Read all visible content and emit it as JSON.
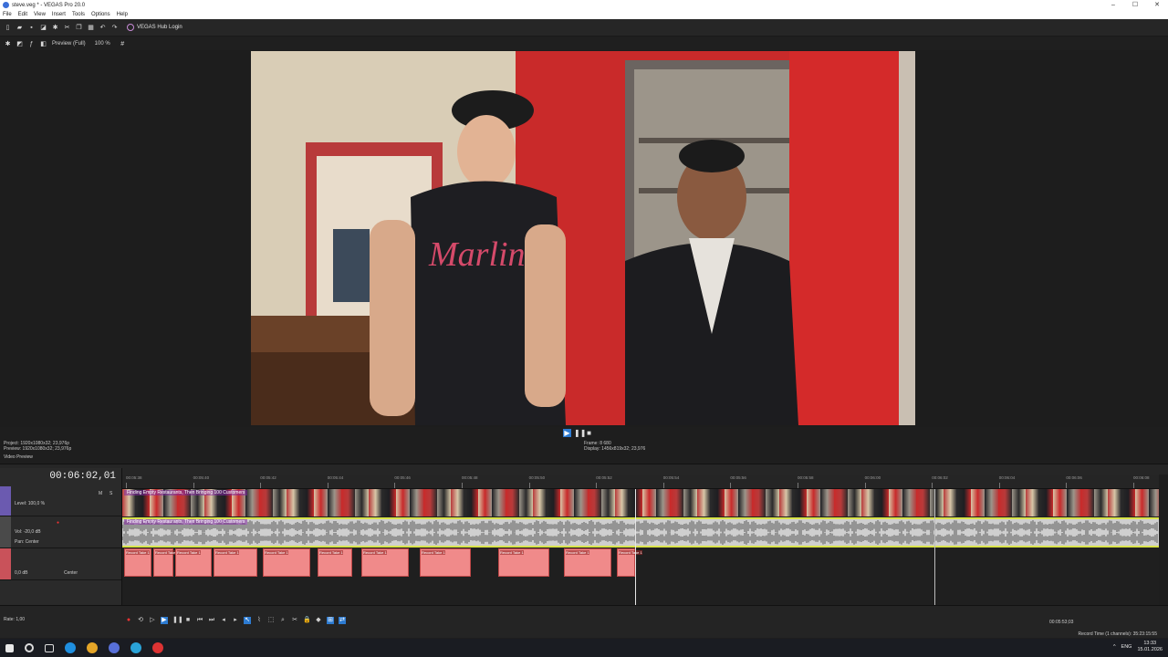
{
  "window": {
    "title": "steve.veg * - VEGAS Pro 20.0",
    "controls": [
      "–",
      "☐",
      "✕"
    ]
  },
  "menu": [
    "File",
    "Edit",
    "View",
    "Insert",
    "Tools",
    "Options",
    "Help"
  ],
  "toolbar": {
    "hub_label": "VEGAS Hub Login"
  },
  "preview_toolbar": {
    "preview_quality": "Preview (Full)",
    "zoom": "100 %"
  },
  "preview": {
    "project_line1": "Project:   1920x1080x32; 23,976p",
    "project_line2": "Preview:  1920x1080x32; 23,976p",
    "frame_line1": "Frame:     8 680",
    "frame_line2": "Display:   1456x819x32; 23,976",
    "tab_label": "Video Preview"
  },
  "timeline": {
    "timecode": "00:06:02,01",
    "video_track": {
      "level": "Level: 100,0 %",
      "clip_title": "Finding Empty Restaurants, Then Bringing 100 Customers"
    },
    "audio_track1": {
      "vol": "Vol:  -20,0 dB",
      "pan": "Pan:  Center",
      "clip_title": "Finding Empty Restaurants, Then Bringing 100 Customers"
    },
    "audio_track2": {
      "vol": "0,0 dB",
      "pan": "Center"
    },
    "ruler_labels": [
      "00:05:38",
      "00:05:40",
      "00:05:42",
      "00:05:44",
      "00:05:46",
      "00:05:48",
      "00:05:50",
      "00:05:52",
      "00:05:54",
      "00:05:56",
      "00:05:58",
      "00:06:00",
      "00:06:02",
      "00:06:04",
      "00:06:06",
      "00:06:08"
    ],
    "audio_clips": [
      "Record Take 1",
      "Record Take 1",
      "Record Take 1",
      "Record Take 1",
      "Record Take 1",
      "Record Take 1",
      "Record Take 1",
      "Record Take 1",
      "Record Take 1",
      "Record Take 1",
      "Record Take 1"
    ],
    "track_label_prefix": "Track 2 - 3.00"
  },
  "bottom": {
    "rate": "Rate: 1,00",
    "position": "00:05:53;03",
    "record_time": "Record Time (1 channels): 35:23:15:55"
  },
  "tray": {
    "lang": "ENG",
    "time": "13:33",
    "date": "15.01.2026"
  }
}
